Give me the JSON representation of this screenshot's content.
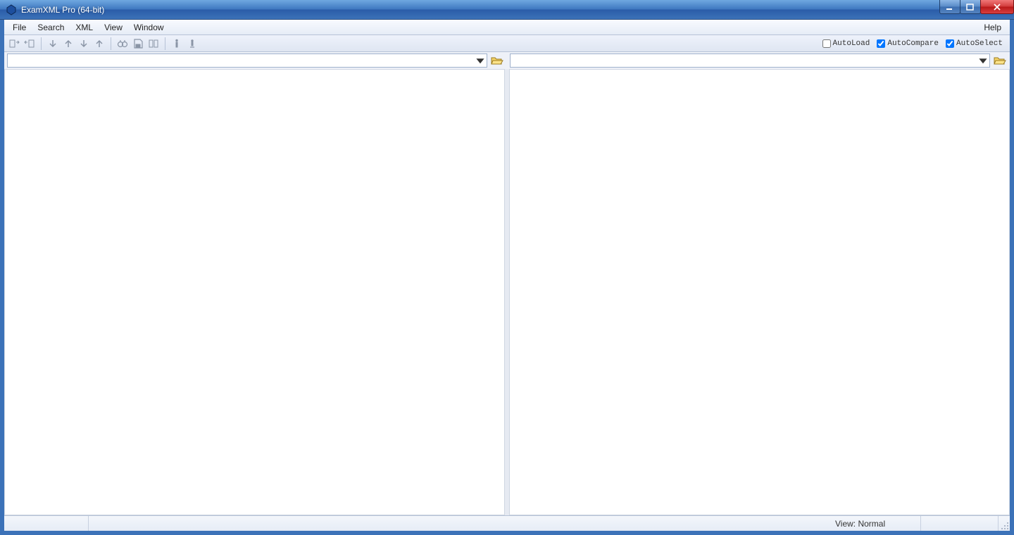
{
  "window": {
    "title": "ExamXML Pro (64-bit)"
  },
  "menus": {
    "file": "File",
    "search": "Search",
    "xml": "XML",
    "view": "View",
    "window": "Window",
    "help": "Help"
  },
  "toolbar": {
    "icons": {
      "sync_left": "sync-left-icon",
      "sync_right": "sync-right-icon",
      "down_single": "arrow-down-icon",
      "up_single": "arrow-up-icon",
      "down_double": "arrow-down-icon",
      "up_double": "arrow-up-icon",
      "binoculars": "binoculars-icon",
      "save": "save-icon",
      "compare": "compare-icon",
      "info": "info-icon",
      "options": "options-icon"
    },
    "auto": {
      "autoload_label": "AutoLoad",
      "autoload_checked": false,
      "autocompare_label": "AutoCompare",
      "autocompare_checked": true,
      "autoselect_label": "AutoSelect",
      "autoselect_checked": true
    }
  },
  "left_file": {
    "path": ""
  },
  "right_file": {
    "path": ""
  },
  "status": {
    "view_label": "View: Normal"
  }
}
